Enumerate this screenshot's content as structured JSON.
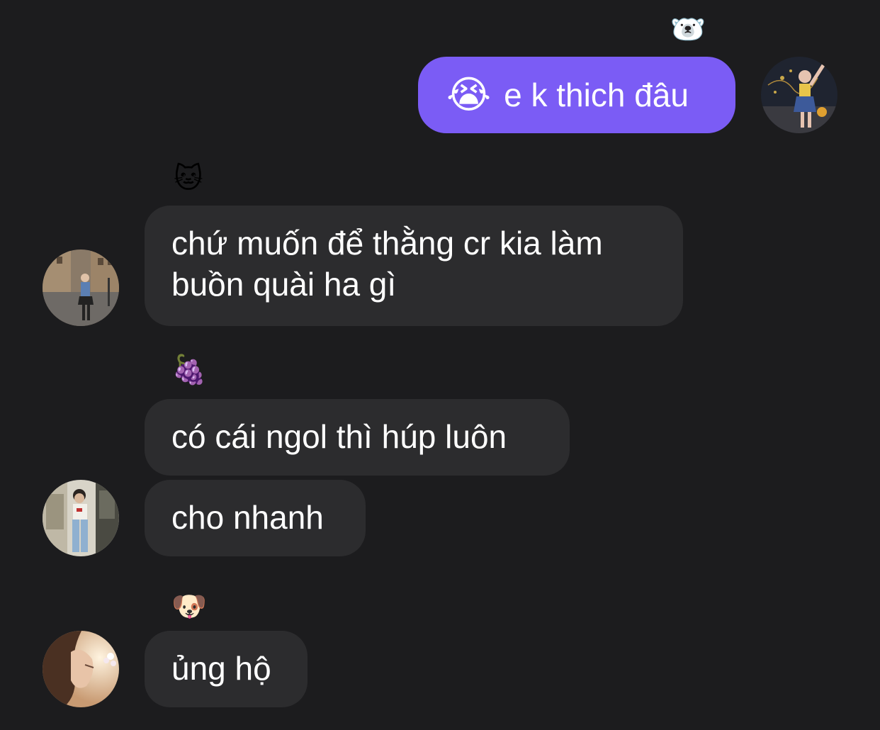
{
  "messages": [
    {
      "sender_emoji": "🐻‍❄️",
      "text": "e k thich đâu",
      "reaction_emoji": "😭",
      "direction": "outgoing"
    },
    {
      "sender_emoji": "🐱",
      "text": "chứ muốn để thằng cr kia làm buồn quài ha gì",
      "direction": "incoming"
    },
    {
      "sender_emoji": "🍇",
      "text": "có cái ngol thì húp luôn",
      "direction": "incoming"
    },
    {
      "text": "cho nhanh",
      "direction": "incoming"
    },
    {
      "sender_emoji": "🐶",
      "text": "ủng hộ",
      "direction": "incoming"
    }
  ],
  "colors": {
    "background": "#1c1c1e",
    "incoming_bubble": "#2c2c2e",
    "outgoing_bubble": "#7b5cf5",
    "text": "#ffffff"
  }
}
